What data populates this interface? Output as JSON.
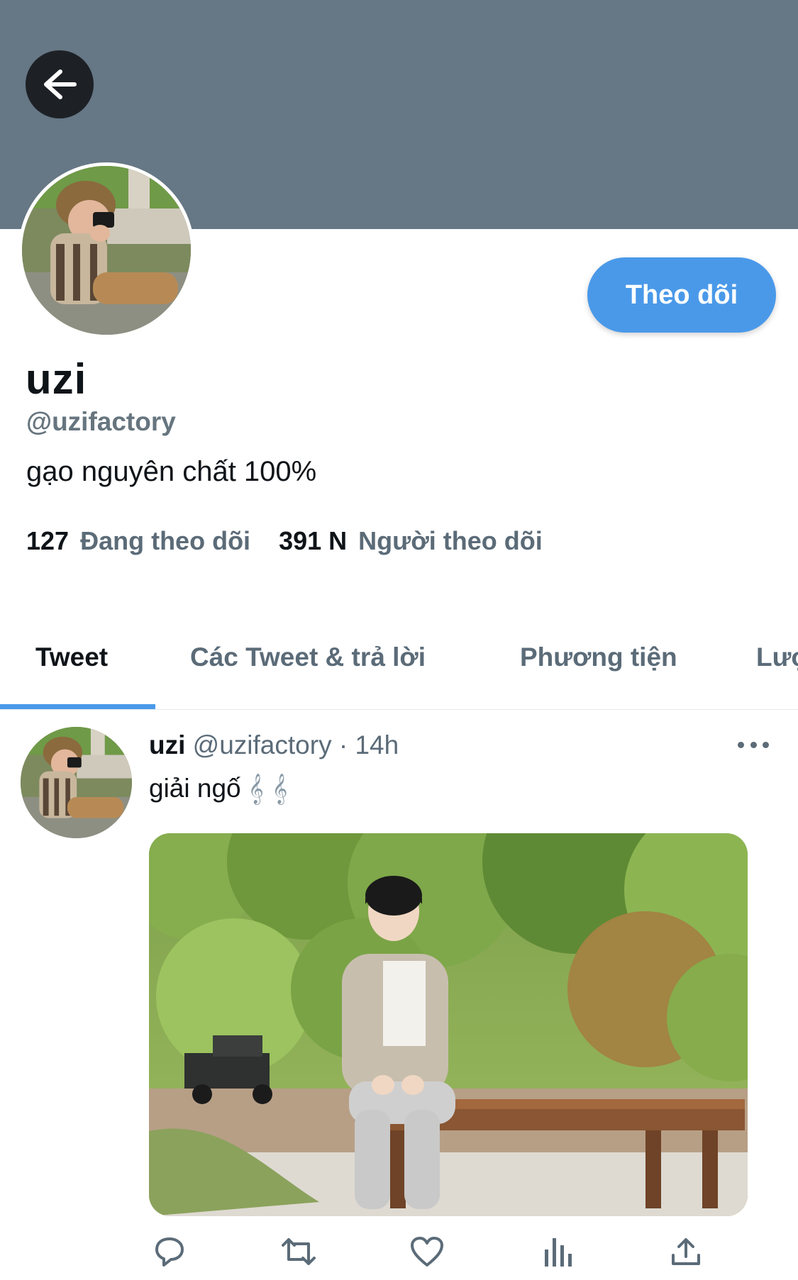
{
  "header": {
    "back_icon": "arrow-left-icon",
    "banner_color": "#667785"
  },
  "profile": {
    "display_name": "uzi",
    "handle": "@uzifactory",
    "bio": "gạo nguyên chất 100%",
    "follow_label": "Theo dõi",
    "following_count": "127",
    "following_label": "Đang theo dõi",
    "followers_count": "391 N",
    "followers_label": "Người theo dõi"
  },
  "tabs": [
    {
      "label": "Tweet",
      "active": true
    },
    {
      "label": "Các Tweet & trả lời",
      "active": false
    },
    {
      "label": "Phương tiện",
      "active": false
    },
    {
      "label": "Lượt thích",
      "active": false
    }
  ],
  "tweet": {
    "name": "uzi",
    "handle": "@uzifactory",
    "separator": " · ",
    "time": "14h",
    "text": "giải ngố",
    "emoji": "𝄞 𝄞",
    "actions": [
      "reply-icon",
      "retweet-icon",
      "like-icon",
      "analytics-icon",
      "share-icon"
    ]
  },
  "colors": {
    "accent": "#4a99e9",
    "secondary_text": "#5b6b78"
  }
}
